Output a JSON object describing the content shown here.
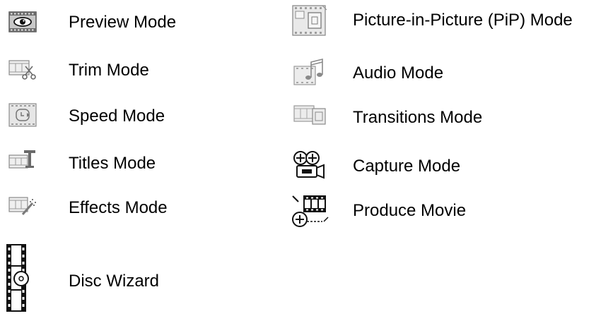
{
  "legend": {
    "items": [
      {
        "id": "preview",
        "label": "Preview Mode",
        "icon": "preview-mode-icon"
      },
      {
        "id": "trim",
        "label": "Trim Mode",
        "icon": "trim-mode-icon"
      },
      {
        "id": "speed",
        "label": "Speed Mode",
        "icon": "speed-mode-icon"
      },
      {
        "id": "titles",
        "label": "Titles Mode",
        "icon": "titles-mode-icon"
      },
      {
        "id": "effects",
        "label": "Effects Mode",
        "icon": "effects-mode-icon"
      },
      {
        "id": "disc-wizard",
        "label": "Disc Wizard",
        "icon": "disc-wizard-icon"
      },
      {
        "id": "pip",
        "label": "Picture-in-Picture (PiP) Mode",
        "icon": "pip-mode-icon"
      },
      {
        "id": "audio",
        "label": "Audio Mode",
        "icon": "audio-mode-icon"
      },
      {
        "id": "transitions",
        "label": "Transitions Mode",
        "icon": "transitions-mode-icon"
      },
      {
        "id": "capture",
        "label": "Capture Mode",
        "icon": "capture-mode-icon"
      },
      {
        "id": "produce",
        "label": "Produce Movie",
        "icon": "produce-movie-icon"
      }
    ]
  }
}
